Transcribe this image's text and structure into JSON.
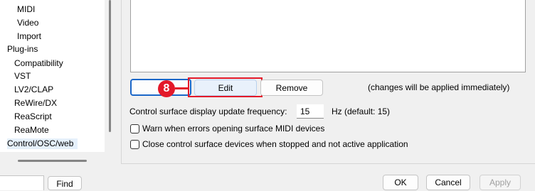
{
  "tree": {
    "items": [
      {
        "label": "MIDI"
      },
      {
        "label": "Video"
      },
      {
        "label": "Import"
      },
      {
        "label": "Plug-ins"
      },
      {
        "label": "Compatibility"
      },
      {
        "label": "VST"
      },
      {
        "label": "LV2/CLAP"
      },
      {
        "label": "ReWire/DX"
      },
      {
        "label": "ReaScript"
      },
      {
        "label": "ReaMote"
      },
      {
        "label": "Control/OSC/web"
      }
    ]
  },
  "buttons": {
    "add": "",
    "edit": "Edit",
    "remove": "Remove"
  },
  "annotation": {
    "step_number": "8",
    "color": "#e3192a"
  },
  "notes": {
    "changes_applied": "(changes will be applied immediately)"
  },
  "frequency": {
    "label": "Control surface display update frequency:",
    "value": "15",
    "unit_hint": "Hz (default: 15)"
  },
  "options": {
    "warn_label": "Warn when errors opening surface MIDI devices",
    "warn_checked": false,
    "close_label": "Close control surface devices when stopped and not active application",
    "close_checked": false
  },
  "footer": {
    "find_value": "",
    "find_label": "Find",
    "ok_label": "OK",
    "cancel_label": "Cancel",
    "apply_label": "Apply"
  },
  "colors": {
    "focus_blue": "#1a66c8",
    "annotation_red": "#e3192a"
  }
}
